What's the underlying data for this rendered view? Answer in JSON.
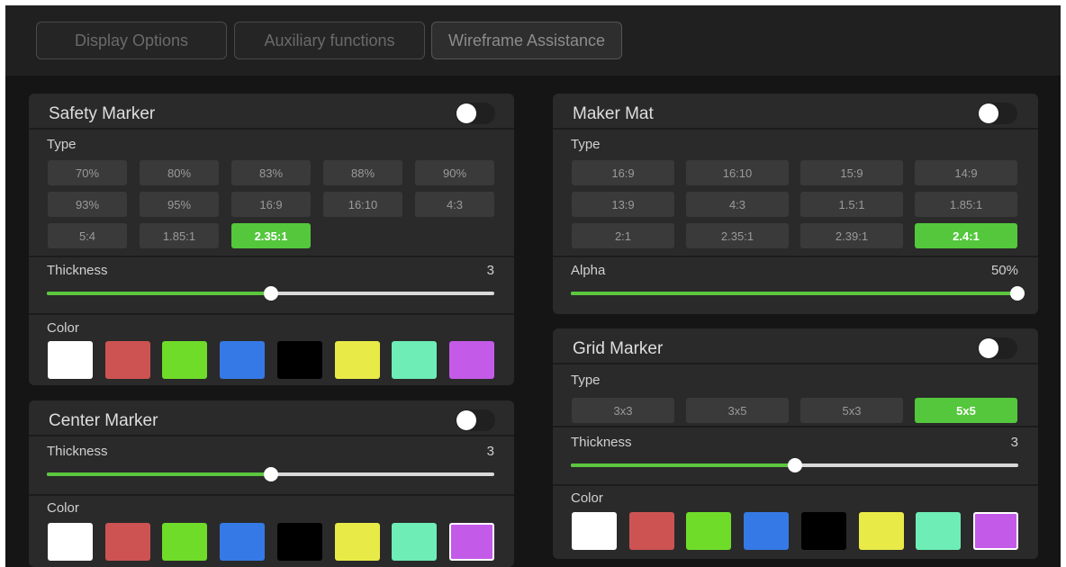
{
  "tabs": [
    "Display Options",
    "Auxiliary functions",
    "Wireframe Assistance"
  ],
  "colors": {
    "white": "#ffffff",
    "red": "#cd5353",
    "green": "#6fdc2a",
    "blue": "#3579e6",
    "black": "#000000",
    "yellow": "#e8eb47",
    "teal": "#6eedb6",
    "purple": "#c45ae8",
    "accent": "#54c73c"
  },
  "safety": {
    "title": "Safety Marker",
    "toggle_on": false,
    "type_label": "Type",
    "types": [
      "70%",
      "80%",
      "83%",
      "88%",
      "90%",
      "93%",
      "95%",
      "16:9",
      "16:10",
      "4:3",
      "5:4",
      "1.85:1",
      "2.35:1"
    ],
    "selected_type": "2.35:1",
    "thickness_label": "Thickness",
    "thickness_value": "3",
    "thickness_level": 0.5,
    "color_label": "Color"
  },
  "center": {
    "title": "Center Marker",
    "toggle_on": false,
    "thickness_label": "Thickness",
    "thickness_value": "3",
    "thickness_level": 0.5,
    "color_label": "Color",
    "selected_color": "purple"
  },
  "mat": {
    "title": "Maker Mat",
    "toggle_on": false,
    "type_label": "Type",
    "types": [
      "16:9",
      "16:10",
      "15:9",
      "14:9",
      "13:9",
      "4:3",
      "1.5:1",
      "1.85:1",
      "2:1",
      "2.35:1",
      "2.39:1",
      "2.4:1"
    ],
    "selected_type": "2.4:1",
    "alpha_label": "Alpha",
    "alpha_value": "50%",
    "alpha_level": 1.0
  },
  "grid": {
    "title": "Grid Marker",
    "toggle_on": false,
    "type_label": "Type",
    "types": [
      "3x3",
      "3x5",
      "5x3",
      "5x5"
    ],
    "selected_type": "5x5",
    "thickness_label": "Thickness",
    "thickness_value": "3",
    "thickness_level": 0.5,
    "color_label": "Color",
    "selected_color": "purple"
  }
}
